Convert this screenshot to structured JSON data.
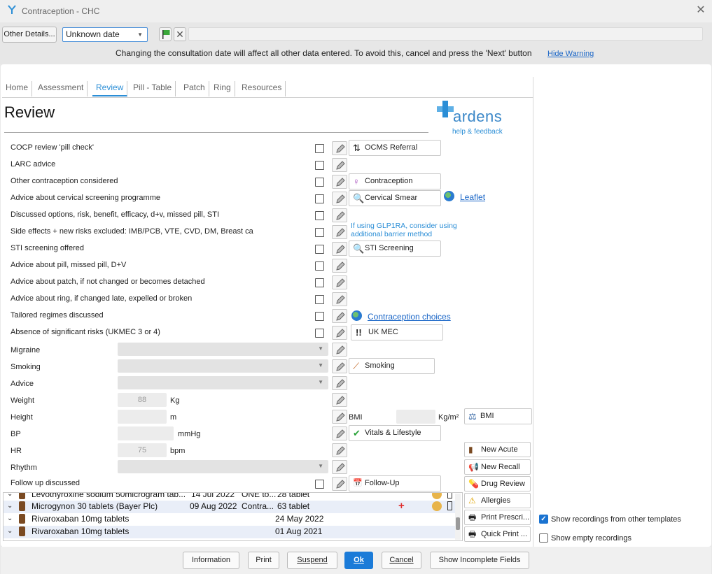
{
  "window": {
    "title": "Contraception - CHC"
  },
  "toolbar": {
    "other_details": "Other Details...",
    "date_value": "Unknown date",
    "warning": "Changing the consultation date will affect all other data entered. To avoid this, cancel and press the 'Next' button",
    "hide_warning": "Hide Warning"
  },
  "tabs": [
    "Home",
    "Assessment",
    "Review",
    "Pill - Table",
    "Patch",
    "Ring",
    "Resources"
  ],
  "active_tab": "Review",
  "page_title": "Review",
  "brand": {
    "name": "ardens",
    "help": "help & feedback"
  },
  "rows": [
    "COCP review 'pill check'",
    "LARC advice",
    "Other contraception considered",
    "Advice about cervical screening programme",
    "Discussed options, risk, benefit, efficacy, d+v, missed pill, STI",
    "Side effects + new risks excluded: IMB/PCB, VTE, CVD, DM, Breast ca",
    "STI screening offered",
    "Advice about pill, missed pill, D+V",
    "Advice about patch, if not changed or becomes detached",
    "Advice about ring, if changed late, expelled or broken",
    "Tailored regimes discussed",
    "Absence of significant risks (UKMEC 3 or 4)",
    "Migraine",
    "Smoking",
    "Advice",
    "Weight",
    "Height",
    "BP",
    "HR",
    "Rhythm",
    "Follow up discussed"
  ],
  "side_buttons": {
    "ocms": "OCMS Referral",
    "contraception": "Contraception",
    "cervical": "Cervical Smear",
    "sti": "STI Screening",
    "ukmec": "UK MEC",
    "smoking": "Smoking",
    "bmi": "BMI",
    "vitals": "Vitals & Lifestyle",
    "followup": "Follow-Up"
  },
  "links": {
    "leaflet": "Leaflet",
    "choices": "Contraception choices"
  },
  "glp_note": "If using GLP1RA, consider using additional barrier method",
  "measurements": {
    "weight": {
      "placeholder": "88",
      "unit": "Kg"
    },
    "height": {
      "unit": "m"
    },
    "bmi_label": "BMI",
    "bmi_unit": "Kg/m²",
    "bp": {
      "unit": "mmHg"
    },
    "hr": {
      "placeholder": "75",
      "unit": "bpm"
    }
  },
  "medications": [
    {
      "name": "Levothyroxine sodium 50microgram tab...",
      "date": "14 Jul 2022",
      "dose": "ONE to...",
      "qty": "28 tablet"
    },
    {
      "name": "Microgynon 30 tablets (Bayer Plc)",
      "date": "09 Aug 2022",
      "dose": "Contra...",
      "qty": "63 tablet"
    },
    {
      "name": "Rivaroxaban 10mg tablets",
      "date": "24 May 2022"
    },
    {
      "name": "Rivaroxaban 10mg tablets",
      "date": "01 Aug 2021"
    }
  ],
  "actions": [
    "New Acute",
    "New Recall",
    "Drug Review",
    "Allergies",
    "Print Prescri...",
    "Quick Print ..."
  ],
  "options": {
    "show_other": "Show recordings from other templates",
    "show_other_checked": true,
    "show_empty": "Show empty recordings",
    "show_empty_checked": false
  },
  "footer": {
    "information": "Information",
    "print": "Print",
    "suspend": "Suspend",
    "ok": "Ok",
    "cancel": "Cancel",
    "incomplete": "Show Incomplete Fields"
  },
  "colors": {
    "accent": "#2b8ed6",
    "primary_button": "#1b7bd8",
    "link": "#1a66c7"
  }
}
